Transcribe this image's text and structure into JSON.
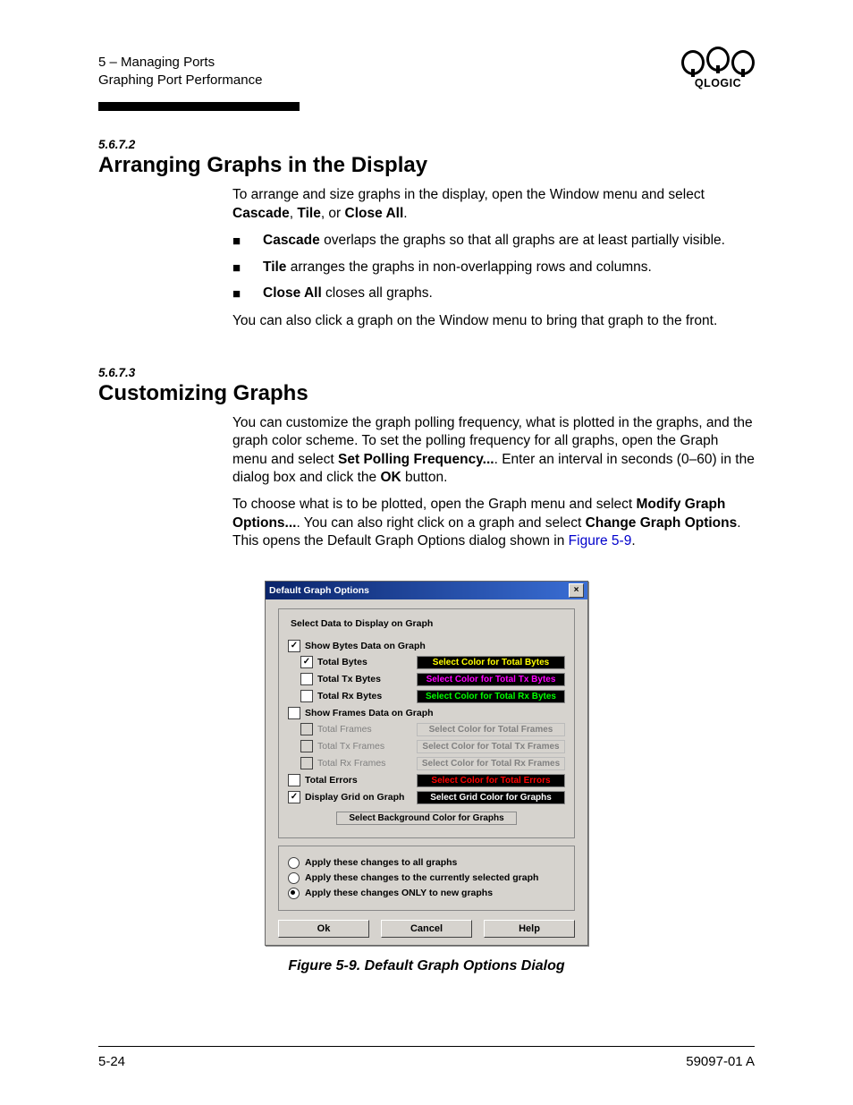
{
  "header": {
    "chapter": "5 – Managing Ports",
    "section": "Graphing Port Performance",
    "logo_text": "QLOGIC"
  },
  "s1": {
    "num": "5.6.7.2",
    "title": "Arranging Graphs in the Display",
    "p1a": "To arrange and size graphs in the display, open the Window menu and select ",
    "b1": "Cascade",
    "c1": ", ",
    "b2": "Tile",
    "c2": ", or ",
    "b3": "Close All",
    "p1e": ".",
    "li1b": "Cascade",
    "li1t": " overlaps the graphs so that all graphs are at least partially visible.",
    "li2b": "Tile",
    "li2t": " arranges the graphs in non-overlapping rows and columns.",
    "li3b": "Close All",
    "li3t": " closes all graphs.",
    "p2": "You can also click a graph on the Window menu to bring that graph to the front."
  },
  "s2": {
    "num": "5.6.7.3",
    "title": "Customizing Graphs",
    "p1a": "You can customize the graph polling frequency, what is plotted in the graphs, and the graph color scheme. To set the polling frequency for all graphs, open the Graph menu and select ",
    "p1b": "Set Polling Frequency...",
    "p1c": ". Enter an interval in seconds (0–60) in the dialog box and click the ",
    "p1d": "OK",
    "p1e": " button.",
    "p2a": "To choose what is to be plotted, open the Graph menu and select ",
    "p2b": "Modify Graph Options...",
    "p2c": ". You can also right click on a graph and select ",
    "p2d": "Change Graph Options",
    "p2e": ". This opens the Default Graph Options dialog shown in ",
    "p2link": "Figure 5-9",
    "p2f": "."
  },
  "dialog": {
    "title": "Default Graph Options",
    "group_title": "Select Data to Display on Graph",
    "show_bytes": "Show Bytes Data on Graph",
    "total_bytes": "Total Bytes",
    "total_tx_bytes": "Total Tx Bytes",
    "total_rx_bytes": "Total Rx Bytes",
    "show_frames": "Show Frames Data on Graph",
    "total_frames": "Total Frames",
    "total_tx_frames": "Total Tx Frames",
    "total_rx_frames": "Total Rx Frames",
    "total_errors": "Total Errors",
    "display_grid": "Display Grid on Graph",
    "cb_total_bytes": "Select Color for Total Bytes",
    "cb_total_tx_bytes": "Select Color for Total Tx Bytes",
    "cb_total_rx_bytes": "Select Color for Total Rx Bytes",
    "cb_total_frames": "Select Color for Total Frames",
    "cb_total_tx_frames": "Select Color for Total Tx Frames",
    "cb_total_rx_frames": "Select Color for Total Rx Frames",
    "cb_total_errors": "Select Color for Total Errors",
    "cb_grid": "Select Grid Color for Graphs",
    "bg_btn": "Select Background Color for Graphs",
    "r1": "Apply these changes to all graphs",
    "r2": "Apply these changes to the currently selected graph",
    "r3": "Apply these changes ONLY to new graphs",
    "ok": "Ok",
    "cancel": "Cancel",
    "help": "Help"
  },
  "fig_caption": "Figure 5-9.  Default Graph Options Dialog",
  "footer": {
    "left": "5-24",
    "right": "59097-01 A"
  }
}
